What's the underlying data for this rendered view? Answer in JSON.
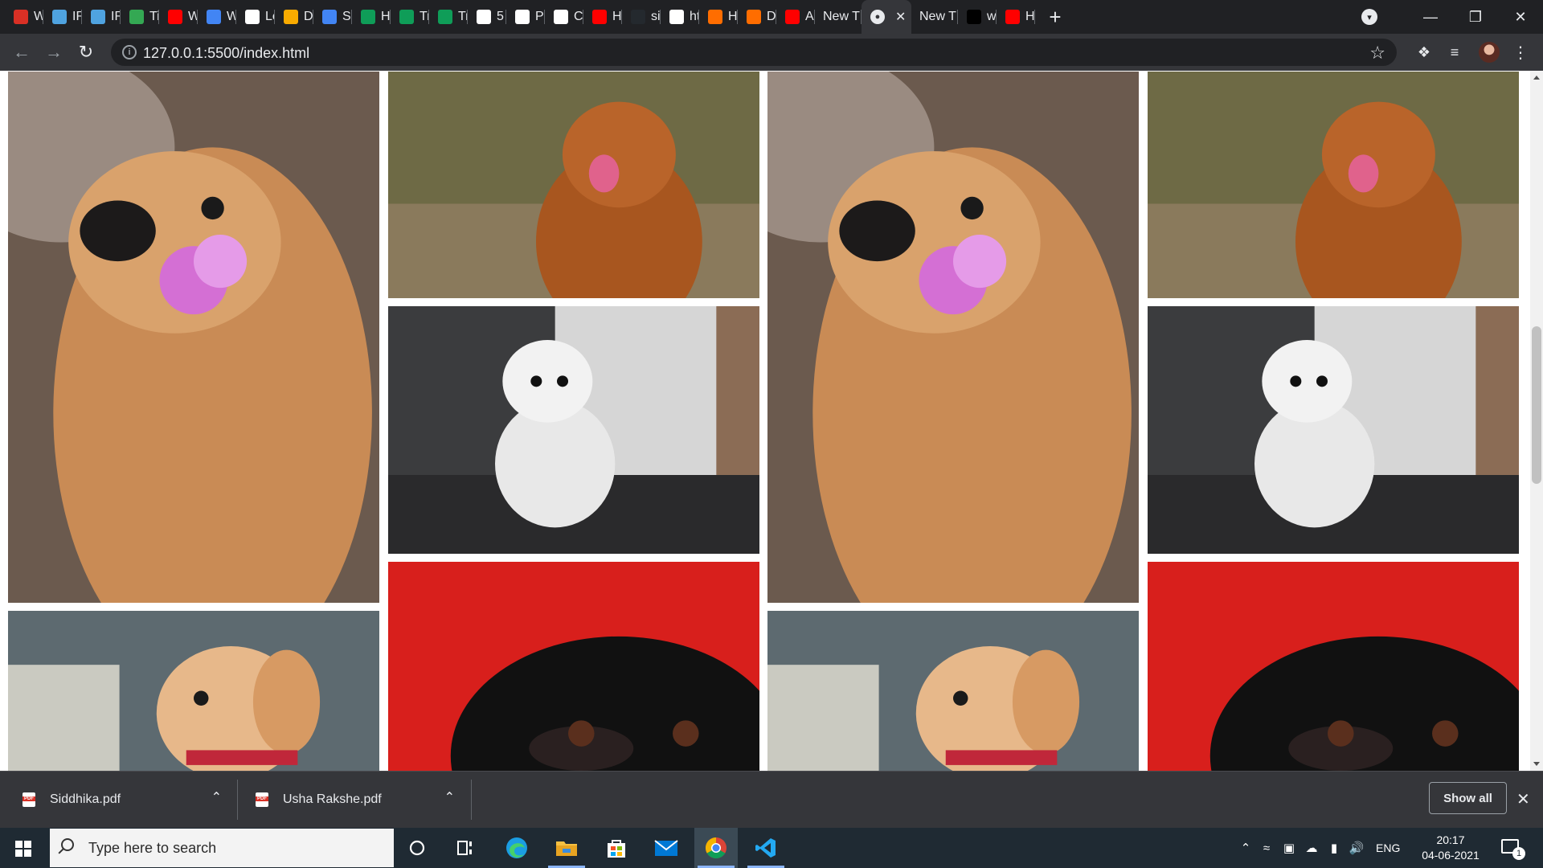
{
  "browser": {
    "tabs": [
      {
        "label": "W",
        "icon": "gmail-icon",
        "color": "#d93025"
      },
      {
        "label": "IR",
        "icon": "wave-icon",
        "color": "#4fa3e0"
      },
      {
        "label": "IR",
        "icon": "wave-icon",
        "color": "#4fa3e0"
      },
      {
        "label": "Ti",
        "icon": "spiral-icon",
        "color": "#34a853"
      },
      {
        "label": "W",
        "icon": "youtube-icon",
        "color": "#ff0000"
      },
      {
        "label": "W",
        "icon": "docs-icon",
        "color": "#4285f4"
      },
      {
        "label": "Le",
        "icon": "google-icon",
        "color": "#ffffff"
      },
      {
        "label": "D",
        "icon": "layers-icon",
        "color": "#f9ab00"
      },
      {
        "label": "Sl",
        "icon": "docs-icon",
        "color": "#4285f4"
      },
      {
        "label": "H",
        "icon": "w-icon",
        "color": "#0f9d58"
      },
      {
        "label": "Tr",
        "icon": "w-icon",
        "color": "#0f9d58"
      },
      {
        "label": "Tr",
        "icon": "w-icon",
        "color": "#0f9d58"
      },
      {
        "label": "5",
        "icon": "f-icon",
        "color": "#ffffff"
      },
      {
        "label": "Pl",
        "icon": "codepen-icon",
        "color": "#ffffff"
      },
      {
        "label": "Co",
        "icon": "codepen-icon",
        "color": "#ffffff"
      },
      {
        "label": "H",
        "icon": "youtube-icon",
        "color": "#ff0000"
      },
      {
        "label": "si",
        "icon": "github-icon",
        "color": "#24292e"
      },
      {
        "label": "ht",
        "icon": "google-icon",
        "color": "#ffffff"
      },
      {
        "label": "H",
        "icon": "stripes-icon",
        "color": "#ff6d00"
      },
      {
        "label": "D",
        "icon": "stripes-icon",
        "color": "#ff6d00"
      },
      {
        "label": "A",
        "icon": "youtube-icon",
        "color": "#ff0000"
      }
    ],
    "tab_new1": "New T",
    "tab_active_icon": "globe-icon",
    "tab_new2": "New T",
    "tab_after": [
      {
        "label": "w",
        "icon": "app-icon",
        "color": "#000000"
      },
      {
        "label": "H",
        "icon": "youtube-icon",
        "color": "#ff0000"
      }
    ],
    "url": "127.0.0.1:5500/index.html"
  },
  "gallery": {
    "photos": [
      {
        "subject": "golden retriever holding pink flower",
        "bg": "#6b5a4e"
      },
      {
        "subject": "brown dog with tongue out",
        "bg": "#6e6a45"
      },
      {
        "subject": "white fluffy dog sitting",
        "bg": "#3b3c3e"
      },
      {
        "subject": "golden puppy",
        "bg": "#5d6a70"
      },
      {
        "subject": "black pug on red background",
        "bg": "#d81f1c"
      }
    ]
  },
  "downloads": {
    "items": [
      {
        "name": "Siddhika.pdf"
      },
      {
        "name": "Usha Rakshe.pdf"
      }
    ],
    "show_all": "Show all"
  },
  "taskbar": {
    "search_placeholder": "Type here to search",
    "language": "ENG",
    "time": "20:17",
    "date": "04-06-2021",
    "notification_count": "1"
  }
}
